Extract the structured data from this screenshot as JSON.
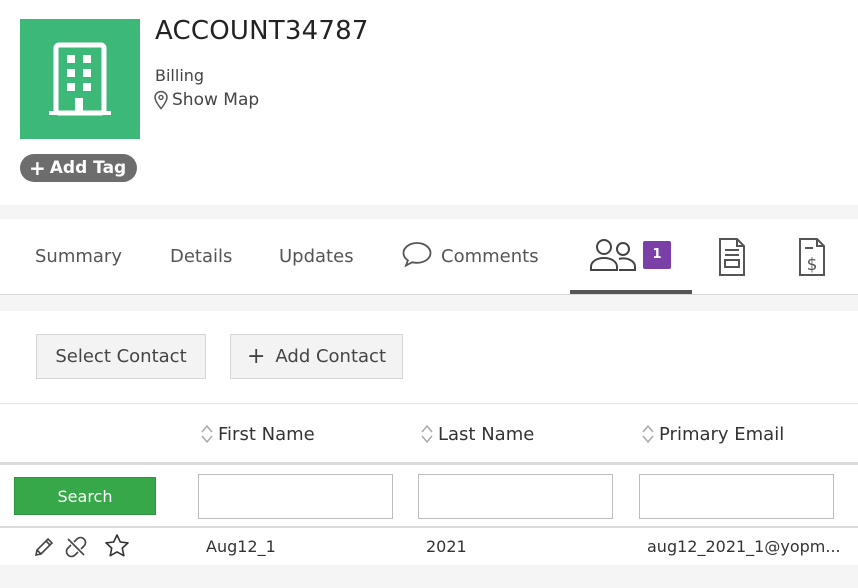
{
  "account": {
    "name": "ACCOUNT34787",
    "type": "Billing",
    "show_map_label": "Show Map",
    "add_tag_label": "Add Tag",
    "avatar_icon": "building-icon",
    "avatar_color": "#3cb878"
  },
  "tabs": [
    {
      "label": "Summary"
    },
    {
      "label": "Details"
    },
    {
      "label": "Updates"
    },
    {
      "label": "Comments",
      "icon": "comment-icon"
    },
    {
      "label": "",
      "icon": "contacts-icon",
      "badge": "1",
      "active": true
    },
    {
      "label": "",
      "icon": "document-icon"
    },
    {
      "label": "",
      "icon": "invoice-dollar-icon"
    }
  ],
  "actions": {
    "select_contact": "Select Contact",
    "add_contact": "Add Contact"
  },
  "table": {
    "columns": [
      "First Name",
      "Last Name",
      "Primary Email"
    ],
    "search_label": "Search",
    "rows": [
      {
        "first_name": "Aug12_1",
        "last_name": "2021",
        "email": "aug12_2021_1@yopm..."
      }
    ]
  },
  "colors": {
    "accent_green": "#37a84a",
    "badge_purple": "#7b3fa8"
  }
}
